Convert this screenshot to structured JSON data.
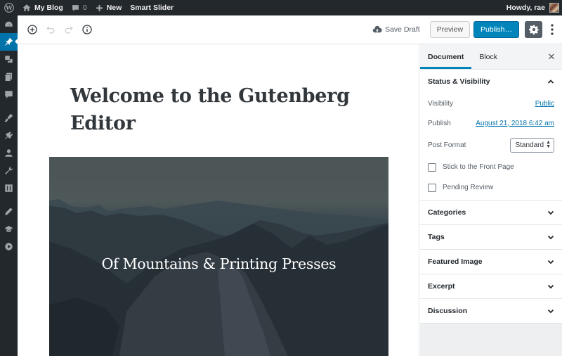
{
  "admin_bar": {
    "site_name": "My Blog",
    "comments_count": "0",
    "new_label": "New",
    "smart_slider_label": "Smart Slider",
    "howdy": "Howdy, rae"
  },
  "admin_menu": {
    "items": [
      "dashboard",
      "posts",
      "media",
      "pages",
      "comments",
      "appearance",
      "plugins",
      "users",
      "tools",
      "settings",
      "edit",
      "learn",
      "smart-slider"
    ],
    "active": "posts"
  },
  "toolbar": {
    "save_draft": "Save Draft",
    "preview": "Preview",
    "publish": "Publish…"
  },
  "post": {
    "title": "Welcome to the Gutenberg Editor",
    "cover_text": "Of Mountains & Printing Presses"
  },
  "sidebar": {
    "tabs": [
      "Document",
      "Block"
    ],
    "active_tab": "Document",
    "status_panel": {
      "title": "Status & Visibility",
      "visibility_label": "Visibility",
      "visibility_value": "Public",
      "publish_label": "Publish",
      "publish_value": "August 21, 2018 6:42 am",
      "post_format_label": "Post Format",
      "post_format_value": "Standard",
      "stick_label": "Stick to the Front Page",
      "stick_checked": false,
      "pending_label": "Pending Review",
      "pending_checked": false
    },
    "panels": [
      "Categories",
      "Tags",
      "Featured Image",
      "Excerpt",
      "Discussion"
    ]
  },
  "colors": {
    "admin_bar": "#23282d",
    "accent": "#0085ba",
    "link": "#0073aa"
  }
}
